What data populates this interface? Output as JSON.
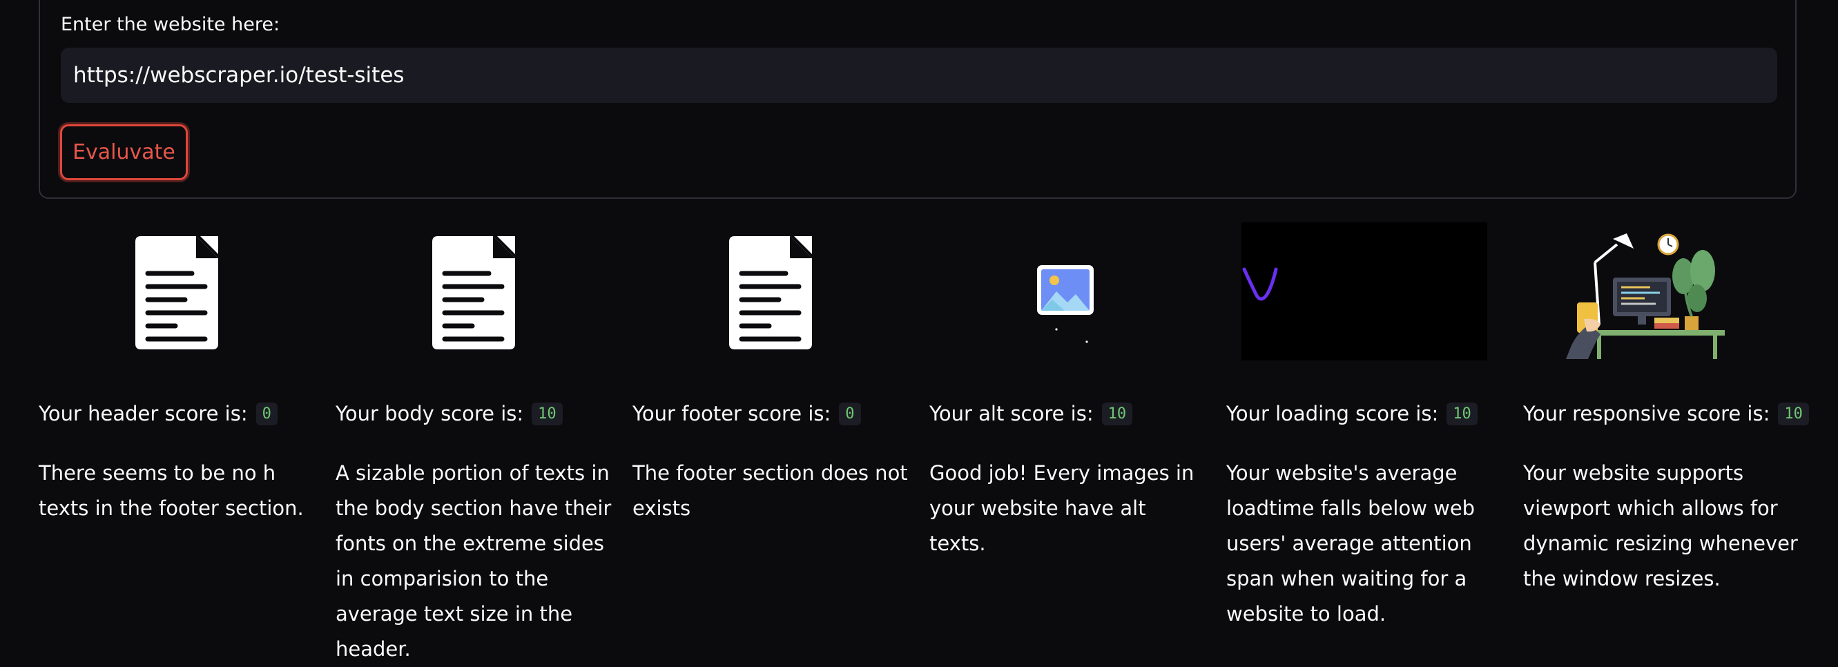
{
  "form": {
    "label": "Enter the website here:",
    "url_value": "https://webscraper.io/test-sites",
    "button_label": "Evaluvate"
  },
  "results": [
    {
      "label": "Your header score is:",
      "score": "0",
      "description": "There seems to be no h texts in the footer section.",
      "icon": "document-icon"
    },
    {
      "label": "Your body score is:",
      "score": "10",
      "description": "A sizable portion of texts in the body section have their fonts on the extreme sides in comparision to the average text size in the header.",
      "icon": "document-icon"
    },
    {
      "label": "Your footer score is:",
      "score": "0",
      "description": "The footer section does not exists",
      "icon": "document-icon"
    },
    {
      "label": "Your alt score is:",
      "score": "10",
      "description": "Good job! Every images in your website have alt texts.",
      "icon": "image-icon"
    },
    {
      "label": "Your loading score is:",
      "score": "10",
      "description": "Your website's average loadtime falls below web users' average attention span when waiting for a website to load.",
      "icon": "loading-animation"
    },
    {
      "label": "Your responsive score is:",
      "score": "10",
      "description": "Your website supports viewport which allows for dynamic resizing whenever the window resizes.",
      "icon": "desk-illustration"
    }
  ],
  "colors": {
    "background": "#0b0b0e",
    "input_bg": "#1a1b22",
    "accent_red": "#e0473b",
    "score_green": "#6ec872",
    "loading_purple": "#6a2ff0"
  }
}
